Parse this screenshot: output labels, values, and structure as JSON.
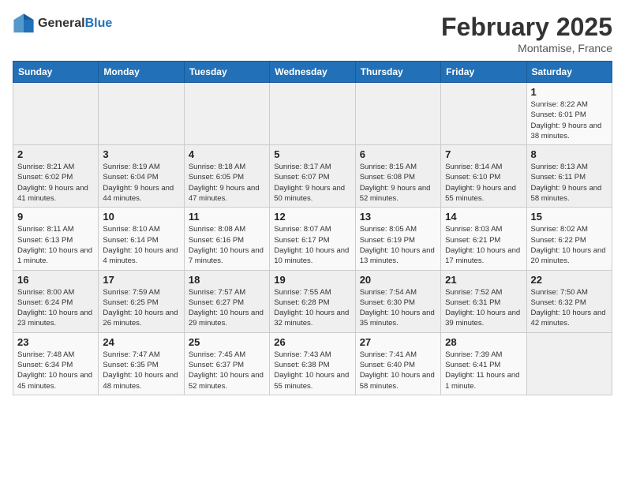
{
  "header": {
    "logo_general": "General",
    "logo_blue": "Blue",
    "month_title": "February 2025",
    "location": "Montamise, France"
  },
  "weekdays": [
    "Sunday",
    "Monday",
    "Tuesday",
    "Wednesday",
    "Thursday",
    "Friday",
    "Saturday"
  ],
  "weeks": [
    [
      {
        "day": "",
        "info": ""
      },
      {
        "day": "",
        "info": ""
      },
      {
        "day": "",
        "info": ""
      },
      {
        "day": "",
        "info": ""
      },
      {
        "day": "",
        "info": ""
      },
      {
        "day": "",
        "info": ""
      },
      {
        "day": "1",
        "info": "Sunrise: 8:22 AM\nSunset: 6:01 PM\nDaylight: 9 hours and 38 minutes."
      }
    ],
    [
      {
        "day": "2",
        "info": "Sunrise: 8:21 AM\nSunset: 6:02 PM\nDaylight: 9 hours and 41 minutes."
      },
      {
        "day": "3",
        "info": "Sunrise: 8:19 AM\nSunset: 6:04 PM\nDaylight: 9 hours and 44 minutes."
      },
      {
        "day": "4",
        "info": "Sunrise: 8:18 AM\nSunset: 6:05 PM\nDaylight: 9 hours and 47 minutes."
      },
      {
        "day": "5",
        "info": "Sunrise: 8:17 AM\nSunset: 6:07 PM\nDaylight: 9 hours and 50 minutes."
      },
      {
        "day": "6",
        "info": "Sunrise: 8:15 AM\nSunset: 6:08 PM\nDaylight: 9 hours and 52 minutes."
      },
      {
        "day": "7",
        "info": "Sunrise: 8:14 AM\nSunset: 6:10 PM\nDaylight: 9 hours and 55 minutes."
      },
      {
        "day": "8",
        "info": "Sunrise: 8:13 AM\nSunset: 6:11 PM\nDaylight: 9 hours and 58 minutes."
      }
    ],
    [
      {
        "day": "9",
        "info": "Sunrise: 8:11 AM\nSunset: 6:13 PM\nDaylight: 10 hours and 1 minute."
      },
      {
        "day": "10",
        "info": "Sunrise: 8:10 AM\nSunset: 6:14 PM\nDaylight: 10 hours and 4 minutes."
      },
      {
        "day": "11",
        "info": "Sunrise: 8:08 AM\nSunset: 6:16 PM\nDaylight: 10 hours and 7 minutes."
      },
      {
        "day": "12",
        "info": "Sunrise: 8:07 AM\nSunset: 6:17 PM\nDaylight: 10 hours and 10 minutes."
      },
      {
        "day": "13",
        "info": "Sunrise: 8:05 AM\nSunset: 6:19 PM\nDaylight: 10 hours and 13 minutes."
      },
      {
        "day": "14",
        "info": "Sunrise: 8:03 AM\nSunset: 6:21 PM\nDaylight: 10 hours and 17 minutes."
      },
      {
        "day": "15",
        "info": "Sunrise: 8:02 AM\nSunset: 6:22 PM\nDaylight: 10 hours and 20 minutes."
      }
    ],
    [
      {
        "day": "16",
        "info": "Sunrise: 8:00 AM\nSunset: 6:24 PM\nDaylight: 10 hours and 23 minutes."
      },
      {
        "day": "17",
        "info": "Sunrise: 7:59 AM\nSunset: 6:25 PM\nDaylight: 10 hours and 26 minutes."
      },
      {
        "day": "18",
        "info": "Sunrise: 7:57 AM\nSunset: 6:27 PM\nDaylight: 10 hours and 29 minutes."
      },
      {
        "day": "19",
        "info": "Sunrise: 7:55 AM\nSunset: 6:28 PM\nDaylight: 10 hours and 32 minutes."
      },
      {
        "day": "20",
        "info": "Sunrise: 7:54 AM\nSunset: 6:30 PM\nDaylight: 10 hours and 35 minutes."
      },
      {
        "day": "21",
        "info": "Sunrise: 7:52 AM\nSunset: 6:31 PM\nDaylight: 10 hours and 39 minutes."
      },
      {
        "day": "22",
        "info": "Sunrise: 7:50 AM\nSunset: 6:32 PM\nDaylight: 10 hours and 42 minutes."
      }
    ],
    [
      {
        "day": "23",
        "info": "Sunrise: 7:48 AM\nSunset: 6:34 PM\nDaylight: 10 hours and 45 minutes."
      },
      {
        "day": "24",
        "info": "Sunrise: 7:47 AM\nSunset: 6:35 PM\nDaylight: 10 hours and 48 minutes."
      },
      {
        "day": "25",
        "info": "Sunrise: 7:45 AM\nSunset: 6:37 PM\nDaylight: 10 hours and 52 minutes."
      },
      {
        "day": "26",
        "info": "Sunrise: 7:43 AM\nSunset: 6:38 PM\nDaylight: 10 hours and 55 minutes."
      },
      {
        "day": "27",
        "info": "Sunrise: 7:41 AM\nSunset: 6:40 PM\nDaylight: 10 hours and 58 minutes."
      },
      {
        "day": "28",
        "info": "Sunrise: 7:39 AM\nSunset: 6:41 PM\nDaylight: 11 hours and 1 minute."
      },
      {
        "day": "",
        "info": ""
      }
    ]
  ]
}
